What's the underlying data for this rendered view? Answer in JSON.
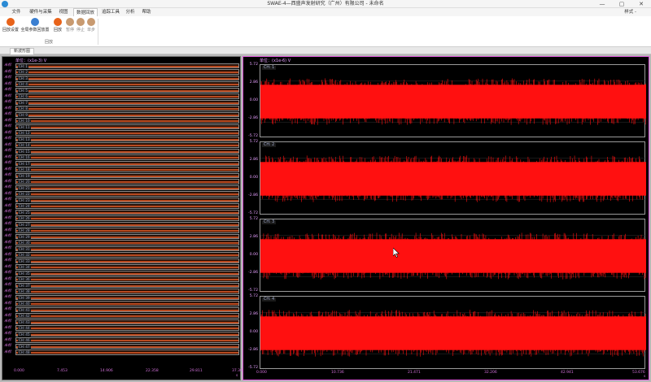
{
  "window": {
    "title": "SWAE-4—西盛声发射研究（广州）有限公司 - 未命名",
    "minimize": "—",
    "maximize": "▢",
    "close": "✕"
  },
  "menu": {
    "items": [
      "文件",
      "硬件与采集",
      "视图",
      "数据回放",
      "追踪工具",
      "分析",
      "帮助"
    ],
    "active_index": 3,
    "style_label": "样式 -"
  },
  "ribbon": {
    "buttons": [
      {
        "label": "回放设置",
        "enabled": true,
        "color": "#e8631a"
      },
      {
        "label": "全局参数回放置",
        "enabled": true,
        "color": "#3a7fd1"
      },
      {
        "label": "回放",
        "enabled": true,
        "color": "#e8631a"
      },
      {
        "label": "暂停",
        "enabled": false,
        "color": "#c89a70"
      },
      {
        "label": "停止",
        "enabled": false,
        "color": "#c89a70"
      },
      {
        "label": "单步",
        "enabled": false,
        "color": "#c89a70"
      }
    ],
    "group_label": "回放"
  },
  "doc_tab": {
    "label": "新波形图"
  },
  "left_panel": {
    "unit": "单位：(x1e-3) V",
    "y_label": "未标",
    "channels": [
      "CH: 1",
      "CH: 2",
      "CH: 3",
      "CH: 4",
      "CH: 5",
      "CH: 6",
      "CH: 7",
      "CH: 8",
      "CH: 9",
      "CH: 10",
      "CH: 11",
      "CH: 12",
      "CH: 13",
      "CH: 14",
      "CH: 15",
      "CH: 16",
      "CH: 17",
      "CH: 18",
      "CH: 19",
      "CH: 20",
      "CH: 21",
      "CH: 22",
      "CH: 23",
      "CH: 24",
      "CH: 25",
      "CH: 26",
      "CH: 27",
      "CH: 28",
      "CH: 29",
      "CH: 30",
      "CH: 31",
      "CH: 32",
      "CH: 33",
      "CH: 34",
      "CH: 35",
      "CH: 36",
      "CH: 37",
      "CH: 38",
      "CH: 39",
      "CH: 40",
      "CH: 41",
      "CH: 42",
      "CH: 43",
      "CH: 44",
      "CH: 45",
      "CH: 46",
      "CH: 47",
      "CH: 48"
    ],
    "x_ticks": [
      "0.000",
      "7.453",
      "14.906",
      "22.358",
      "29.811",
      "37.363"
    ],
    "x_unit": "s",
    "signal_color": "#b84a20"
  },
  "right_panel": {
    "unit": "单位：(x1e-6) V",
    "channels": [
      {
        "name": "CH: 1",
        "y_ticks": [
          "5.72",
          "2.86",
          "0.00",
          "-2.86",
          "-5.72"
        ]
      },
      {
        "name": "CH: 2",
        "y_ticks": [
          "5.72",
          "2.86",
          "0.00",
          "-2.86",
          "-5.72"
        ]
      },
      {
        "name": "CH: 3",
        "y_ticks": [
          "5.72",
          "2.86",
          "0.00",
          "-2.86",
          "-5.72"
        ]
      },
      {
        "name": "CH: 4",
        "y_ticks": [
          "5.72",
          "2.86",
          "0.00",
          "-2.86",
          "-5.72"
        ]
      }
    ],
    "x_ticks": [
      "0.000",
      "10.736",
      "21.471",
      "32.206",
      "42.941",
      "53.676"
    ],
    "x_unit": "s",
    "signal_color": "#ff1010"
  }
}
